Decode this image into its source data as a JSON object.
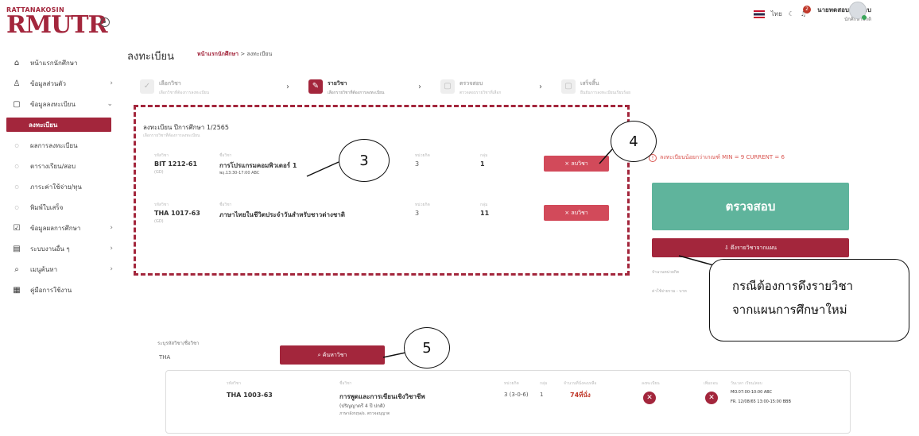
{
  "brand": {
    "small": "RATTANAKOSIN",
    "big": "RMUTR"
  },
  "topbar": {
    "lang": "ไทย",
    "badge": "2",
    "user_name": "นายทดสอบ ทดสอบ",
    "user_role": "นักศึกษาปกติ"
  },
  "sidebar": {
    "items": [
      {
        "label": "หน้าแรกนักศึกษา",
        "icon": "home-icon",
        "glyph": "⌂"
      },
      {
        "label": "ข้อมูลส่วนตัว",
        "icon": "user-icon",
        "glyph": "♙"
      },
      {
        "label": "ข้อมูลลงทะเบียน",
        "icon": "book-icon",
        "glyph": "▢"
      },
      {
        "label": "ลงทะเบียน",
        "active": true
      },
      {
        "label": "ผลการลงทะเบียน"
      },
      {
        "label": "ตารางเรียน/สอบ"
      },
      {
        "label": "ภาระค่าใช้จ่าย/ทุน"
      },
      {
        "label": "พิมพ์ใบเสร็จ"
      },
      {
        "label": "ข้อมูลผลการศึกษา",
        "icon": "checkbox-icon",
        "glyph": "☑"
      },
      {
        "label": "ระบบงานอื่น ๆ",
        "icon": "clipboard-icon",
        "glyph": "▤"
      },
      {
        "label": "เมนูค้นหา",
        "icon": "search-icon",
        "glyph": "⌕"
      },
      {
        "label": "คู่มือการใช้งาน",
        "icon": "document-icon",
        "glyph": "▦"
      }
    ]
  },
  "page": {
    "title": "ลงทะเบียน",
    "crumb_home": "หน้าแรกนักศึกษา",
    "crumb_sep": ">",
    "crumb_current": "ลงทะเบียน"
  },
  "steps": [
    {
      "title": "เลือกวิชา",
      "sub": "เลือกวิชาที่ต้องการลงทะเบียน",
      "glyph": "✓"
    },
    {
      "title": "รายวิชา",
      "sub": "เลือกรายวิชาที่ต้องการลงทะเบียน",
      "glyph": "✎"
    },
    {
      "title": "ตรวจสอบ",
      "sub": "ตรวจสอบรายวิชาที่เลือก",
      "glyph": "▢"
    },
    {
      "title": "เสร็จสิ้น",
      "sub": "ยืนยันการลงทะเบียนเรียบร้อย",
      "glyph": "▢"
    }
  ],
  "registration": {
    "title": "ลงทะเบียน ปีการศึกษา 1/2565",
    "subtitle": "เลือกรายวิชาที่ต้องการลงทะเบียน",
    "col_code": "รหัสวิชา",
    "col_name": "ชื่อวิชา",
    "col_credit": "หน่วยกิต",
    "col_group": "กลุ่ม",
    "remove_label": "× ลบวิชา",
    "rows": [
      {
        "code": "BIT 1212-61",
        "section": "(GD)",
        "name": "การโปรแกรมคอมพิวเตอร์ 1",
        "time": "พฤ.13:30-17:00 ABC",
        "credit": "3",
        "group": "1"
      },
      {
        "code": "THA 1017-63",
        "section": "(GD)",
        "name": "ภาษาไทยในชีวิตประจำวันสำหรับชาวต่างชาติ",
        "time": "",
        "credit": "3",
        "group": "11"
      }
    ]
  },
  "right_panel": {
    "warning": "ลงทะเบียนน้อยกว่าเกณฑ์ MIN = 9 CURRENT = 6",
    "check_label": "ตรวจสอบ",
    "pull_label": "⇩ ดึงรายวิชาจากแผน",
    "hint1": "จำนวนหน่วยกิต",
    "hint2": "ค่าใช้จ่ายรวม - บาท"
  },
  "search": {
    "label": "ระบุรหัสวิชา/ชื่อวิชา",
    "value": "THA",
    "button": "⌕ ค้นหาวิชา"
  },
  "result": {
    "col_code": "รหัสวิชา",
    "col_name": "ชื่อวิชา",
    "col_credit": "หน่วยกิต",
    "col_group": "กลุ่ม",
    "col_seats": "จำนวนที่นั่งคงเหลือ",
    "col_a": "ลงทะเบียน",
    "col_b": "เพิ่มถอน",
    "col_time": "วันเวลา เรียน/สอบ",
    "code": "THA 1003-63",
    "name": "การพูดและการเขียนเชิงวิชาชีพ",
    "note1": "(ปริญญาตรี 4 ปี ปกติ)",
    "note2": "ภาษาอังกฤษ/อ. ตรวจอนุญาต",
    "credit": "3 (3-0-6)",
    "group": "1",
    "seats": "74ที่นั่ง",
    "time1": "MO.07:00-10:00 ABC",
    "time2": "FR. 12/08/65 13:00-15:00 BBB"
  },
  "callouts": {
    "c3": "3",
    "c4": "4",
    "c5": "5",
    "speech_line1": "กรณีต้องการดึงรายวิชา",
    "speech_line2": "จากแผนการศึกษาใหม่"
  },
  "colors": {
    "brand": "#a3263c",
    "accent_green": "#5fb49c",
    "warning": "#d9544f"
  }
}
